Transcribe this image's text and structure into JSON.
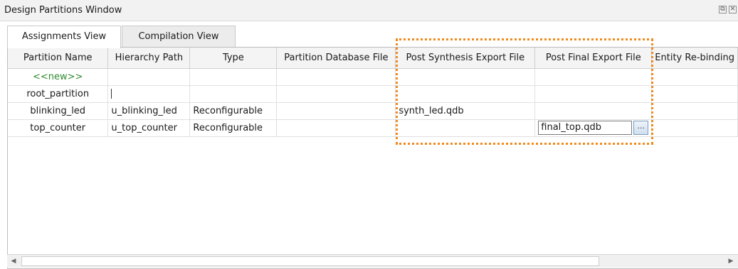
{
  "window": {
    "title": "Design Partitions Window",
    "restore_glyph": "⧉",
    "close_glyph": "✕"
  },
  "tabs": [
    {
      "label": "Assignments View",
      "active": true
    },
    {
      "label": "Compilation View",
      "active": false
    }
  ],
  "table": {
    "columns": [
      "Partition Name",
      "Hierarchy Path",
      "Type",
      "Partition Database File",
      "Post Synthesis Export File",
      "Post Final Export File",
      "Entity Re-binding"
    ],
    "new_row_label": "<<new>>",
    "rows": [
      {
        "name": "root_partition",
        "path": "",
        "type": "",
        "db": "",
        "synth": "",
        "final": "",
        "rebind": ""
      },
      {
        "name": "blinking_led",
        "path": "u_blinking_led",
        "type": "Reconfigurable",
        "db": "",
        "synth": "synth_led.qdb",
        "final": "",
        "rebind": ""
      },
      {
        "name": "top_counter",
        "path": "u_top_counter",
        "type": "Reconfigurable",
        "db": "",
        "synth": "",
        "final": "final_top.qdb",
        "rebind": ""
      }
    ],
    "browse_label": "..."
  },
  "scroll": {
    "left_arrow": "◀",
    "right_arrow": "▶"
  },
  "colors": {
    "highlight": "#f08a1c",
    "new_row_text": "#2e8b2e"
  }
}
